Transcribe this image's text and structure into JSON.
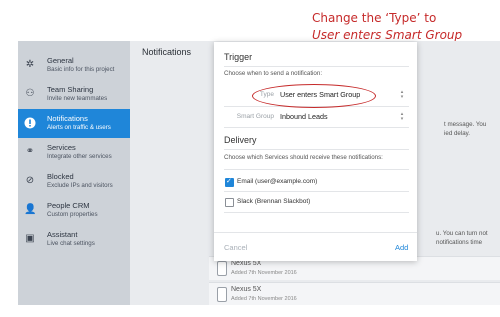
{
  "annotation": {
    "line1": "Change the ‘Type’ to",
    "line2": "User enters Smart Group",
    "color": "#c62a2a"
  },
  "sidebar": {
    "items": [
      {
        "title": "General",
        "subtitle": "Basic info for this project",
        "icon": "gear-icon",
        "active": false
      },
      {
        "title": "Team Sharing",
        "subtitle": "Invite new teammates",
        "icon": "team-icon",
        "active": false
      },
      {
        "title": "Notifications",
        "subtitle": "Alerts on traffic & users",
        "icon": "alert-icon",
        "active": true
      },
      {
        "title": "Services",
        "subtitle": "Integrate other services",
        "icon": "link-icon",
        "active": false
      },
      {
        "title": "Blocked",
        "subtitle": "Exclude IPs and visitors",
        "icon": "blocked-icon",
        "active": false
      },
      {
        "title": "People CRM",
        "subtitle": "Custom properties",
        "icon": "person-icon",
        "active": false
      },
      {
        "title": "Assistant",
        "subtitle": "Live chat settings",
        "icon": "chat-icon",
        "active": false
      }
    ]
  },
  "main": {
    "title": "Notifications",
    "bg_text": [
      "t message. You",
      "ied delay.",
      "u. You can turn not",
      "notifications time"
    ],
    "devices": [
      {
        "name": "Nexus 5X",
        "added": "Added 7th November 2016"
      },
      {
        "name": "Nexus 5X",
        "added": "Added 7th November 2016"
      }
    ]
  },
  "modal": {
    "trigger_heading": "Trigger",
    "trigger_sub": "Choose when to send a notification:",
    "type_label": "Type",
    "type_value": "User enters Smart Group",
    "smart_group_label": "Smart Group",
    "smart_group_value": "Inbound Leads",
    "delivery_heading": "Delivery",
    "delivery_sub": "Choose which Services should receive these notifications:",
    "services": [
      {
        "label": "Email (user@example.com)",
        "checked": true
      },
      {
        "label": "Slack (Brennan Slackbot)",
        "checked": false
      }
    ],
    "cancel": "Cancel",
    "add": "Add"
  },
  "colors": {
    "accent": "#1f86d9",
    "sidebar": "#cdd2d8",
    "annotation": "#c62a2a"
  }
}
